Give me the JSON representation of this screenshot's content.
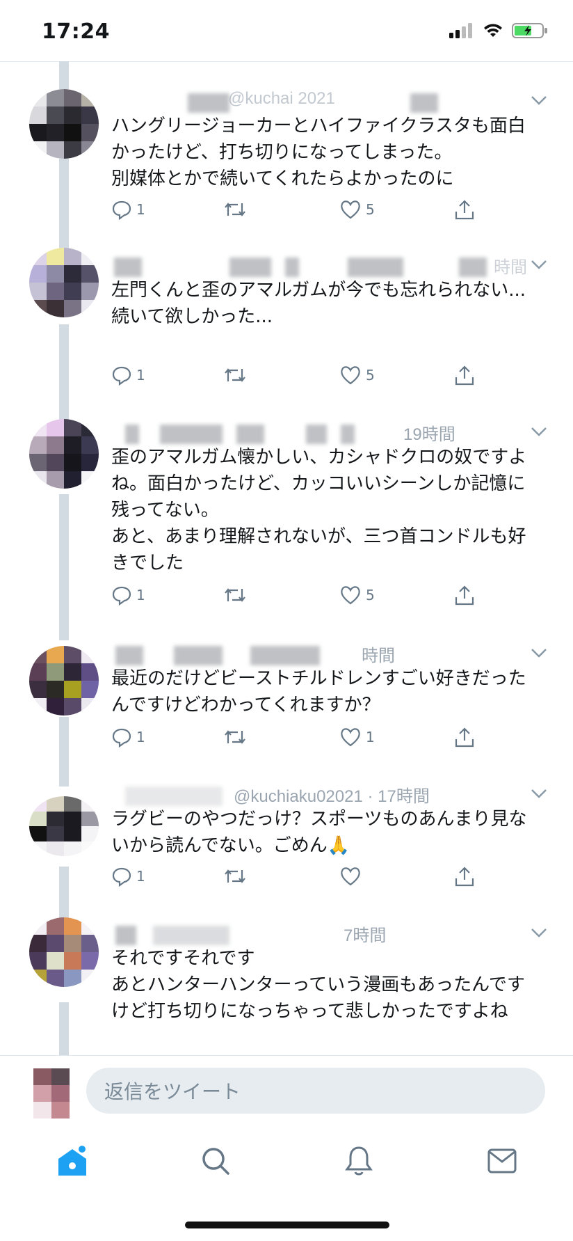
{
  "status_bar": {
    "time": "17:24"
  },
  "colors": {
    "accent": "#1da1f2",
    "icon_gray": "#657786",
    "text": "#14171a",
    "thread_line": "#d3dbe2"
  },
  "tweets": [
    {
      "visible_header": "@kuchai 2021",
      "text": "ハングリージョーカーとハイファイクラスタも面白かったけど、打ち切りになってしまった。\n別媒体とかで続いてくれたらよかったのに",
      "reply_count": "1",
      "like_count": "5"
    },
    {
      "visible_header": "時間",
      "text": "左門くんと歪のアマルガムが今でも忘れられない...\n続いて欲しかった...",
      "reply_count": "1",
      "like_count": "5"
    },
    {
      "visible_header": "19時間",
      "text": "歪のアマルガム懐かしい、カシャドクロの奴ですよね。面白かったけど、カッコいいシーンしか記憶に残ってない。\nあと、あまり理解されないが、三つ首コンドルも好きでした",
      "reply_count": "1",
      "like_count": "5"
    },
    {
      "visible_header": "時間",
      "text": "最近のだけどビーストチルドレンすごい好きだったんですけどわかってくれますか？",
      "reply_count": "1",
      "like_count": "1"
    },
    {
      "visible_header": "@kuchiaku02021 · 17時間",
      "text": "ラグビーのやつだっけ？スポーツものあんまり見ないから読んでない。ごめん🙏",
      "reply_count": "1",
      "like_count": ""
    },
    {
      "visible_header": "7時間",
      "text": "それですそれです\nあとハンターハンターっていう漫画もあったんですけど打ち切りになっちゃって悲しかったですよね",
      "reply_count": "",
      "like_count": ""
    }
  ],
  "reply_box": {
    "placeholder": "返信をツイート"
  },
  "tabs": [
    {
      "name": "home-icon"
    },
    {
      "name": "search-icon"
    },
    {
      "name": "notifications-icon"
    },
    {
      "name": "messages-icon"
    }
  ]
}
